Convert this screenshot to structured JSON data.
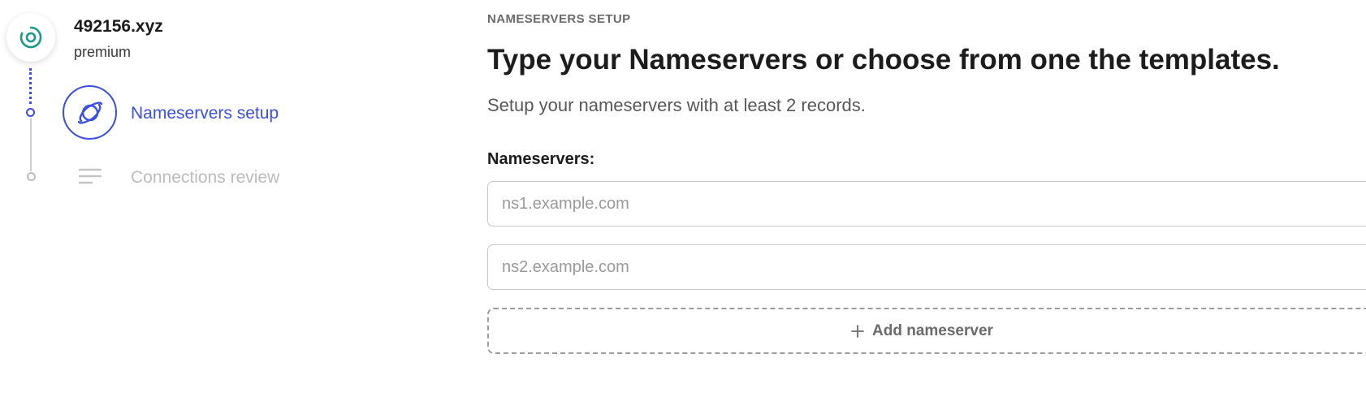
{
  "domain": {
    "name": "492156.xyz",
    "plan": "premium",
    "icon": "target-icon",
    "icon_color": "#1a9a88"
  },
  "steps": [
    {
      "label": "Nameservers setup",
      "icon": "planet-icon",
      "state": "active"
    },
    {
      "label": "Connections review",
      "icon": "lines-icon",
      "state": "inactive"
    }
  ],
  "main": {
    "kicker": "NAMESERVERS SETUP",
    "title": "Type your Nameservers or choose from one the templates.",
    "subtitle": "Setup your nameservers with at least 2 records.",
    "field_label": "Nameservers:",
    "inputs": [
      {
        "value": "",
        "placeholder": "ns1.example.com"
      },
      {
        "value": "",
        "placeholder": "ns2.example.com"
      }
    ],
    "add_button_label": "Add nameserver",
    "add_button_icon": "plus-icon"
  },
  "colors": {
    "accent": "#3b4fe4",
    "brand_teal": "#1a9a88",
    "inactive": "#bcbcbc"
  }
}
